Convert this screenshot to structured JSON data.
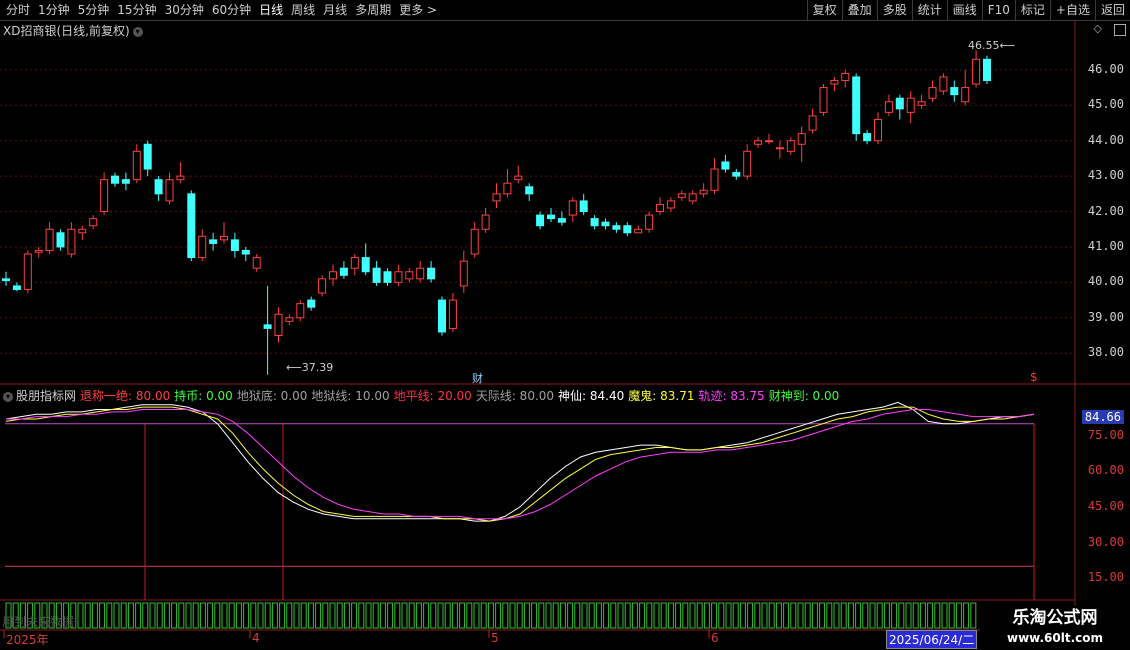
{
  "toolbar": {
    "periods": [
      "分时",
      "1分钟",
      "5分钟",
      "15分钟",
      "30分钟",
      "60分钟",
      "日线",
      "周线",
      "月线",
      "多周期",
      "更多 >"
    ],
    "active": "日线",
    "right": [
      "复权",
      "叠加",
      "多股",
      "统计",
      "画线",
      "F10",
      "标记",
      "+自选",
      "返回"
    ]
  },
  "title": {
    "text": "XD招商银(日线,前复权)"
  },
  "price_axis": [
    "46.00",
    "45.00",
    "44.00",
    "43.00",
    "42.00",
    "41.00",
    "40.00",
    "39.00",
    "38.00"
  ],
  "annotations": {
    "high": "46.55",
    "low": "37.39",
    "cai": "财",
    "dollar": "$"
  },
  "indicator": {
    "name": "股朋指标网",
    "params": [
      {
        "label": "退称一绝: 80.00",
        "color": "#ff4040"
      },
      {
        "label": "持币: 0.00",
        "color": "#40ff40"
      },
      {
        "label": "地狱底: 0.00",
        "color": "#a0a0a0"
      },
      {
        "label": "地狱线: 10.00",
        "color": "#a0a0a0"
      },
      {
        "label": "地平线: 20.00",
        "color": "#ff3050"
      },
      {
        "label": "天际线: 80.00",
        "color": "#a0a0a0"
      },
      {
        "label": "神仙: 84.40",
        "color": "#ffffff"
      },
      {
        "label": "魔鬼: 83.71",
        "color": "#ffff40"
      },
      {
        "label": "轨迹: 83.75",
        "color": "#ff40ff"
      },
      {
        "label": "财神到: 0.00",
        "color": "#40ff40"
      }
    ],
    "axis": [
      "75.00",
      "60.00",
      "45.00",
      "30.00",
      "15.00"
    ],
    "current": "84.66"
  },
  "xaxis": {
    "labels": [
      "2025年",
      "4",
      "5",
      "6"
    ],
    "date": "2025/06/24/二"
  },
  "watermark": "用到未来数据",
  "brand": {
    "name": "乐淘公式网",
    "url": "www.60lt.com"
  },
  "colors": {
    "up": "#ff4040",
    "down": "#40ffff",
    "grid": "#8a1a1a"
  },
  "chart_data": {
    "type": "candlestick",
    "ylim": [
      37.3,
      46.9
    ],
    "candles": [
      [
        40.1,
        40.05,
        40.3,
        39.9
      ],
      [
        39.9,
        39.8,
        40.0,
        39.75
      ],
      [
        39.8,
        40.8,
        40.9,
        39.7
      ],
      [
        40.85,
        40.9,
        41.0,
        40.7
      ],
      [
        40.9,
        41.5,
        41.7,
        40.8
      ],
      [
        41.4,
        41.0,
        41.5,
        40.9
      ],
      [
        40.8,
        41.5,
        41.7,
        40.7
      ],
      [
        41.4,
        41.5,
        41.6,
        41.2
      ],
      [
        41.6,
        41.8,
        41.9,
        41.5
      ],
      [
        42.0,
        42.9,
        43.1,
        41.9
      ],
      [
        43.0,
        42.8,
        43.1,
        42.7
      ],
      [
        42.9,
        42.8,
        43.1,
        42.6
      ],
      [
        42.9,
        43.7,
        43.9,
        42.8
      ],
      [
        43.9,
        43.2,
        44.0,
        43.0
      ],
      [
        42.9,
        42.5,
        43.0,
        42.3
      ],
      [
        42.3,
        42.9,
        43.1,
        42.2
      ],
      [
        42.9,
        43.0,
        43.4,
        42.8
      ],
      [
        42.5,
        40.7,
        42.6,
        40.6
      ],
      [
        40.7,
        41.3,
        41.5,
        40.6
      ],
      [
        41.2,
        41.1,
        41.4,
        40.9
      ],
      [
        41.2,
        41.3,
        41.7,
        41.1
      ],
      [
        41.2,
        40.9,
        41.4,
        40.7
      ],
      [
        40.9,
        40.8,
        41.0,
        40.6
      ],
      [
        40.4,
        40.7,
        40.8,
        40.3
      ],
      [
        38.8,
        38.7,
        39.9,
        37.39
      ],
      [
        38.5,
        39.1,
        39.3,
        38.3
      ],
      [
        38.9,
        39.0,
        39.1,
        38.8
      ],
      [
        39.0,
        39.4,
        39.5,
        38.9
      ],
      [
        39.5,
        39.3,
        39.6,
        39.2
      ],
      [
        39.7,
        40.1,
        40.2,
        39.6
      ],
      [
        40.1,
        40.3,
        40.5,
        39.9
      ],
      [
        40.4,
        40.2,
        40.6,
        40.1
      ],
      [
        40.4,
        40.7,
        40.8,
        40.2
      ],
      [
        40.7,
        40.3,
        41.1,
        40.2
      ],
      [
        40.4,
        40.0,
        40.6,
        39.9
      ],
      [
        40.3,
        40.0,
        40.4,
        39.9
      ],
      [
        40.0,
        40.3,
        40.5,
        39.9
      ],
      [
        40.1,
        40.3,
        40.4,
        40.0
      ],
      [
        40.1,
        40.4,
        40.6,
        40.0
      ],
      [
        40.4,
        40.1,
        40.6,
        40.0
      ],
      [
        39.5,
        38.6,
        39.6,
        38.5
      ],
      [
        38.7,
        39.5,
        39.7,
        38.6
      ],
      [
        39.9,
        40.6,
        40.9,
        39.7
      ],
      [
        40.8,
        41.5,
        41.7,
        40.7
      ],
      [
        41.5,
        41.9,
        42.1,
        41.4
      ],
      [
        42.3,
        42.5,
        42.8,
        42.1
      ],
      [
        42.5,
        42.8,
        43.2,
        42.4
      ],
      [
        42.9,
        43.0,
        43.3,
        42.8
      ],
      [
        42.7,
        42.5,
        42.8,
        42.3
      ],
      [
        41.9,
        41.6,
        42.0,
        41.5
      ],
      [
        41.9,
        41.8,
        42.1,
        41.7
      ],
      [
        41.8,
        41.7,
        42.0,
        41.6
      ],
      [
        41.9,
        42.3,
        42.4,
        41.7
      ],
      [
        42.3,
        42.0,
        42.5,
        41.9
      ],
      [
        41.8,
        41.6,
        41.9,
        41.5
      ],
      [
        41.7,
        41.6,
        41.8,
        41.5
      ],
      [
        41.6,
        41.5,
        41.7,
        41.4
      ],
      [
        41.6,
        41.4,
        41.7,
        41.3
      ],
      [
        41.4,
        41.5,
        41.6,
        41.4
      ],
      [
        41.5,
        41.9,
        42.0,
        41.4
      ],
      [
        42.0,
        42.2,
        42.4,
        41.9
      ],
      [
        42.1,
        42.3,
        42.4,
        42.0
      ],
      [
        42.4,
        42.5,
        42.6,
        42.3
      ],
      [
        42.3,
        42.5,
        42.6,
        42.2
      ],
      [
        42.5,
        42.6,
        42.8,
        42.4
      ],
      [
        42.6,
        43.2,
        43.5,
        42.5
      ],
      [
        43.4,
        43.2,
        43.6,
        43.1
      ],
      [
        43.1,
        43.0,
        43.2,
        42.9
      ],
      [
        43.0,
        43.7,
        43.9,
        42.9
      ],
      [
        43.9,
        44.0,
        44.1,
        43.8
      ],
      [
        44.0,
        44.0,
        44.2,
        43.9
      ],
      [
        43.8,
        43.8,
        44.0,
        43.5
      ],
      [
        43.7,
        44.0,
        44.1,
        43.6
      ],
      [
        43.9,
        44.2,
        44.4,
        43.4
      ],
      [
        44.3,
        44.7,
        44.9,
        44.2
      ],
      [
        44.8,
        45.5,
        45.6,
        44.7
      ],
      [
        45.6,
        45.7,
        45.8,
        45.4
      ],
      [
        45.7,
        45.9,
        46.0,
        45.5
      ],
      [
        45.8,
        44.2,
        45.9,
        44.0
      ],
      [
        44.2,
        44.0,
        44.3,
        43.9
      ],
      [
        44.0,
        44.6,
        44.8,
        43.9
      ],
      [
        44.8,
        45.1,
        45.3,
        44.7
      ],
      [
        45.2,
        44.9,
        45.3,
        44.6
      ],
      [
        44.8,
        45.2,
        45.4,
        44.5
      ],
      [
        45.0,
        45.1,
        45.3,
        44.9
      ],
      [
        45.2,
        45.5,
        45.7,
        45.1
      ],
      [
        45.4,
        45.8,
        45.9,
        45.3
      ],
      [
        45.5,
        45.3,
        45.7,
        45.1
      ],
      [
        45.1,
        45.5,
        46.0,
        45.0
      ],
      [
        45.6,
        46.3,
        46.55,
        45.5
      ],
      [
        46.3,
        45.7,
        46.4,
        45.6
      ]
    ],
    "indicator_ylim": [
      10,
      90
    ],
    "indicator_series": [
      {
        "name": "神仙",
        "color": "#ffffff",
        "values": [
          82,
          83,
          84,
          84,
          85,
          85,
          86,
          86,
          87,
          88,
          88,
          88,
          87,
          85,
          80,
          72,
          64,
          57,
          51,
          47,
          44,
          42,
          41,
          40,
          40,
          40,
          40,
          40,
          40,
          40,
          40,
          39,
          39,
          41,
          45,
          51,
          57,
          62,
          66,
          68,
          69,
          70,
          71,
          71,
          70,
          69,
          69,
          70,
          71,
          72,
          74,
          76,
          78,
          80,
          82,
          84,
          85,
          86,
          87,
          89,
          86,
          81,
          80,
          80,
          81,
          82,
          83,
          83,
          84
        ]
      },
      {
        "name": "魔鬼",
        "color": "#ffff40",
        "values": [
          81,
          82,
          82,
          83,
          84,
          84,
          85,
          86,
          86,
          87,
          87,
          87,
          86,
          84,
          82,
          76,
          68,
          61,
          55,
          50,
          46,
          43,
          42,
          41,
          41,
          41,
          41,
          41,
          41,
          40,
          40,
          40,
          39,
          40,
          42,
          47,
          52,
          57,
          61,
          65,
          67,
          68,
          69,
          70,
          70,
          69,
          69,
          70,
          70,
          71,
          72,
          74,
          76,
          78,
          80,
          82,
          83,
          85,
          86,
          87,
          87,
          84,
          82,
          81,
          81,
          82,
          82,
          83,
          84
        ]
      },
      {
        "name": "轨迹",
        "color": "#ff40ff",
        "values": [
          82,
          82,
          83,
          83,
          83,
          84,
          84,
          85,
          85,
          86,
          86,
          86,
          86,
          85,
          84,
          81,
          76,
          70,
          64,
          58,
          53,
          49,
          46,
          44,
          43,
          42,
          42,
          41,
          41,
          41,
          41,
          40,
          40,
          40,
          41,
          43,
          46,
          50,
          54,
          58,
          61,
          64,
          66,
          67,
          68,
          68,
          68,
          69,
          69,
          70,
          71,
          72,
          73,
          75,
          77,
          79,
          81,
          82,
          84,
          85,
          86,
          86,
          85,
          84,
          83,
          83,
          83,
          83,
          84
        ]
      }
    ],
    "levels": [
      80,
      20
    ]
  }
}
